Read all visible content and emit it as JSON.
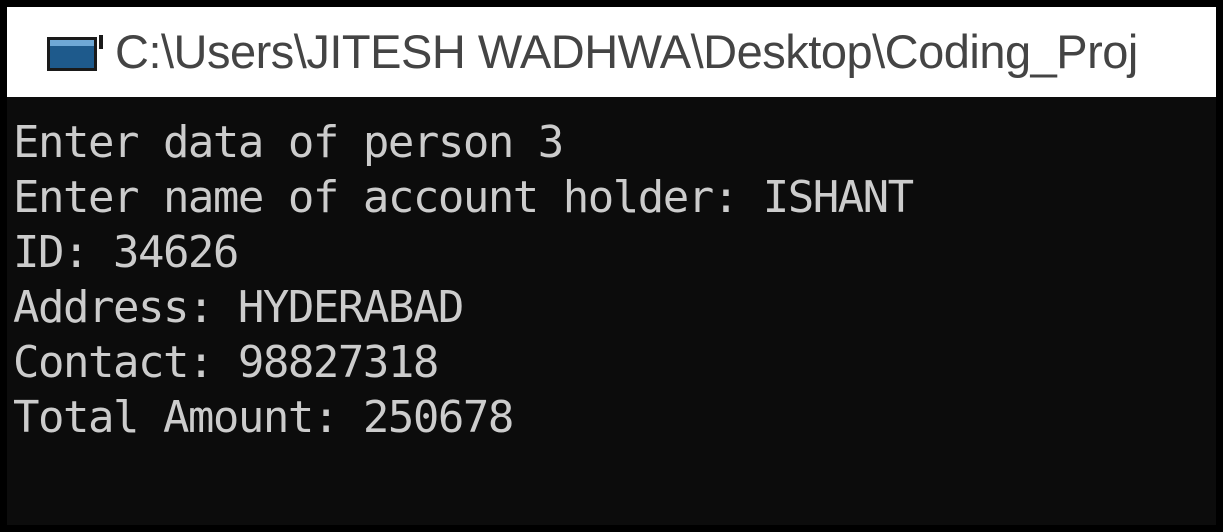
{
  "window": {
    "title": "C:\\Users\\JITESH WADHWA\\Desktop\\Coding_Proj"
  },
  "icons": {
    "app": "console-window-icon"
  },
  "colors": {
    "console_bg": "#0c0c0c",
    "console_text": "#cccccc",
    "titlebar_bg": "#ffffff",
    "titlebar_text": "#444444"
  },
  "console": {
    "lines": [
      "Enter data of person 3",
      "Enter name of account holder: ISHANT",
      "ID: 34626",
      "Address: HYDERABAD",
      "Contact: 98827318",
      "Total Amount: 250678"
    ]
  }
}
